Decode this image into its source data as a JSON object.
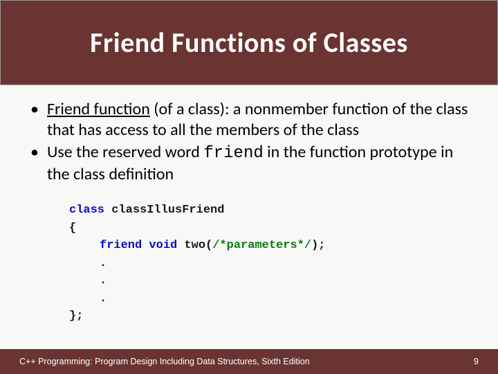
{
  "header": {
    "title": "Friend Functions of Classes"
  },
  "bullets": [
    {
      "term": "Friend function",
      "rest": " (of a class): a nonmember function of the class that has access to all the   members of the class"
    },
    {
      "pre": "Use the reserved word ",
      "code": "friend",
      "post": " in the function prototype in the class definition"
    }
  ],
  "code": {
    "kw_class": "class",
    "classname": " classIllusFriend",
    "open": "{",
    "kw_friend": "friend void",
    "fn": " two",
    "params_open": "(",
    "params_comment": "/*parameters*/",
    "params_close": ");",
    "dot": ".",
    "close": "};"
  },
  "footer": {
    "text": "C++ Programming: Program Design Including Data Structures, Sixth Edition",
    "page": "9"
  }
}
